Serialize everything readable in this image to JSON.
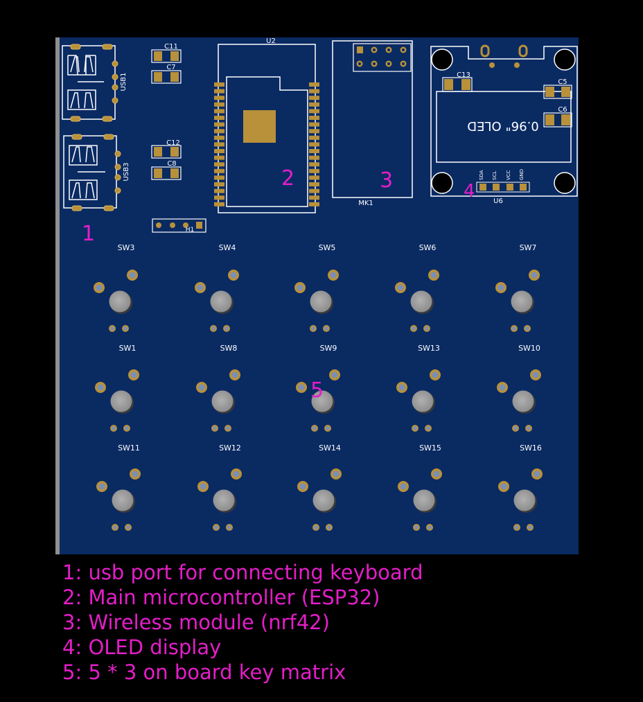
{
  "colors": {
    "background": "#000000",
    "board": "#0a2a62",
    "silkscreen": "#ffffff",
    "pad": "#b8913a",
    "annotation": "#e41ec8",
    "switch_button": "#9a9a9a"
  },
  "components": {
    "usb1": "USB1",
    "usb3": "USB3",
    "c11": "C11",
    "c7": "C7",
    "c12": "C12",
    "c8": "C8",
    "h1": "H1",
    "u2": "U2",
    "mk1": "MK1",
    "u6": "U6",
    "c13": "C13",
    "c5": "C5",
    "c6": "C6",
    "oled_text": "0.96\" OLED",
    "pin_sda": "SDA",
    "pin_scl": "SCL",
    "pin_vcc": "VCC",
    "pin_gnd": "GND"
  },
  "markers": [
    "1",
    "2",
    "3",
    "4",
    "5"
  ],
  "switches": [
    [
      "SW3",
      "SW4",
      "SW5",
      "SW6",
      "SW7"
    ],
    [
      "SW1",
      "SW8",
      "SW9",
      "SW13",
      "SW10"
    ],
    [
      "SW11",
      "SW12",
      "SW14",
      "SW15",
      "SW16"
    ]
  ],
  "legend": [
    "1: usb port for connecting keyboard",
    "2: Main microcontroller (ESP32)",
    "3: Wireless module (nrf42)",
    "4: OLED display",
    "5: 5 * 3 on board key matrix"
  ]
}
